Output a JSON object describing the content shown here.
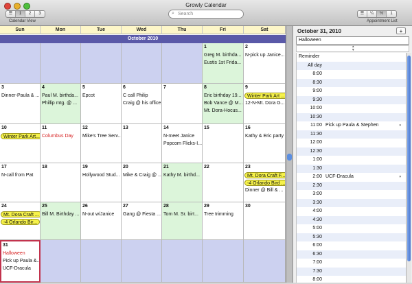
{
  "window": {
    "title": "Growly Calendar"
  },
  "toolbar": {
    "view_segments": [
      "☰",
      "1",
      "2",
      "3"
    ],
    "view_label": "Calendar View",
    "search_placeholder": "Search",
    "appt_segments": [
      "☰",
      "¼",
      "½",
      "1"
    ],
    "appt_label": "Appointment List"
  },
  "calendar": {
    "days_of_week": [
      "Sun",
      "Mon",
      "Tue",
      "Wed",
      "Thu",
      "Fri",
      "Sat"
    ],
    "month_title": "October 2010",
    "weeks": [
      [
        {
          "day": "",
          "events": []
        },
        {
          "day": "",
          "events": []
        },
        {
          "day": "",
          "events": []
        },
        {
          "day": "",
          "events": []
        },
        {
          "day": "",
          "events": []
        },
        {
          "day": "1",
          "events": [
            {
              "text": "Greg M. birthda..."
            },
            {
              "text": "Eustis 1st Frida..."
            }
          ]
        },
        {
          "day": "2",
          "events": [
            {
              "text": "N-pick up Janice..."
            }
          ]
        }
      ],
      [
        {
          "day": "3",
          "events": [
            {
              "text": "Dinner-Paula & ..."
            }
          ]
        },
        {
          "day": "4",
          "events": [
            {
              "text": "Paul M. birthda..."
            },
            {
              "text": "Phillip mtg. @ ..."
            }
          ]
        },
        {
          "day": "5",
          "events": [
            {
              "text": "Epcot"
            }
          ]
        },
        {
          "day": "6",
          "events": [
            {
              "text": "C call Philip"
            },
            {
              "text": "Craig @ his office"
            }
          ]
        },
        {
          "day": "7",
          "events": []
        },
        {
          "day": "8",
          "events": [
            {
              "text": "Eric birthday 19..."
            },
            {
              "text": "Bob Vance @ M..."
            },
            {
              "text": "Mt. Dora-Hocus..."
            }
          ]
        },
        {
          "day": "9",
          "events": [
            {
              "text": "Winter Park Art ...",
              "pill": true
            },
            {
              "text": "12-N-Mt. Dora G..."
            }
          ]
        }
      ],
      [
        {
          "day": "10",
          "events": [
            {
              "text": "Winter Park Art...",
              "pill": true
            }
          ]
        },
        {
          "day": "11",
          "events": [
            {
              "text": "Columbus Day",
              "red": true
            }
          ]
        },
        {
          "day": "12",
          "events": [
            {
              "text": "Mike's Tree Serv..."
            }
          ]
        },
        {
          "day": "13",
          "events": []
        },
        {
          "day": "14",
          "events": [
            {
              "text": "N-meet Janice"
            },
            {
              "text": "Popcorn Flicks-I..."
            }
          ]
        },
        {
          "day": "15",
          "events": []
        },
        {
          "day": "16",
          "events": [
            {
              "text": "Kathy & Eric party"
            }
          ]
        }
      ],
      [
        {
          "day": "17",
          "events": [
            {
              "text": "N-call from Pat"
            }
          ]
        },
        {
          "day": "18",
          "events": []
        },
        {
          "day": "19",
          "events": [
            {
              "text": "Hollywood Stud..."
            }
          ]
        },
        {
          "day": "20",
          "events": [
            {
              "text": "Mike & Craig @ ..."
            }
          ]
        },
        {
          "day": "21",
          "events": [
            {
              "text": "Kathy M. birthd..."
            }
          ]
        },
        {
          "day": "22",
          "events": []
        },
        {
          "day": "23",
          "events": [
            {
              "text": "Mt. Dora Craft F...",
              "pill": true
            },
            {
              "text": "-4 Orlando Bird ...",
              "pill": true
            },
            {
              "text": "Dinner @ Bill & ..."
            }
          ]
        }
      ],
      [
        {
          "day": "24",
          "events": [
            {
              "text": "Mt. Dora Craft ...",
              "pill": true
            },
            {
              "text": "-4 Orlando Bir...",
              "pill": true
            }
          ]
        },
        {
          "day": "25",
          "events": [
            {
              "text": "Bill M. Birthday ..."
            }
          ]
        },
        {
          "day": "26",
          "events": [
            {
              "text": "N-out w/Janice"
            }
          ]
        },
        {
          "day": "27",
          "events": [
            {
              "text": "Gang @ Fiesta ..."
            }
          ]
        },
        {
          "day": "28",
          "events": [
            {
              "text": "Tom M. Sr. birt..."
            }
          ]
        },
        {
          "day": "29",
          "events": [
            {
              "text": "Tree trimming"
            }
          ]
        },
        {
          "day": "30",
          "events": []
        }
      ],
      [
        {
          "day": "31",
          "events": [
            {
              "text": "Halloween",
              "red": true
            },
            {
              "text": "Pick up Paula &..."
            },
            {
              "text": "UCF-Dracula"
            }
          ]
        },
        {
          "day": "",
          "events": []
        },
        {
          "day": "",
          "events": []
        },
        {
          "day": "",
          "events": []
        },
        {
          "day": "",
          "events": []
        },
        {
          "day": "",
          "events": []
        },
        {
          "day": "",
          "events": []
        }
      ]
    ]
  },
  "panel": {
    "date": "October 31, 2010",
    "add_label": "+",
    "title_value": "Halloween",
    "times": [
      {
        "label": "Reminder",
        "left": true,
        "event": ""
      },
      {
        "label": "All day",
        "event": ""
      },
      {
        "label": "8:00",
        "event": ""
      },
      {
        "label": "8:30",
        "event": ""
      },
      {
        "label": "9:00",
        "event": ""
      },
      {
        "label": "9:30",
        "event": ""
      },
      {
        "label": "10:00",
        "event": ""
      },
      {
        "label": "10:30",
        "event": ""
      },
      {
        "label": "11:00",
        "event": "Pick up Paula & Stephen"
      },
      {
        "label": "11:30",
        "event": ""
      },
      {
        "label": "12:00",
        "event": ""
      },
      {
        "label": "12:30",
        "event": ""
      },
      {
        "label": "1:00",
        "event": ""
      },
      {
        "label": "1:30",
        "event": ""
      },
      {
        "label": "2:00",
        "event": "UCF-Dracula"
      },
      {
        "label": "2:30",
        "event": ""
      },
      {
        "label": "3:00",
        "event": ""
      },
      {
        "label": "3:30",
        "event": ""
      },
      {
        "label": "4:00",
        "event": ""
      },
      {
        "label": "4:30",
        "event": ""
      },
      {
        "label": "5:00",
        "event": ""
      },
      {
        "label": "5:30",
        "event": ""
      },
      {
        "label": "6:00",
        "event": ""
      },
      {
        "label": "6:30",
        "event": ""
      },
      {
        "label": "7:00",
        "event": ""
      },
      {
        "label": "7:30",
        "event": ""
      },
      {
        "label": "8:00",
        "event": ""
      }
    ]
  },
  "colors": {
    "month_band": "#5a59a8",
    "empty_cell": "#ccd1f0",
    "weekend_cell": "#dcf5da",
    "pill_event": "#f6f24a",
    "holiday_text": "#d62020",
    "today_border": "#c2334d"
  }
}
